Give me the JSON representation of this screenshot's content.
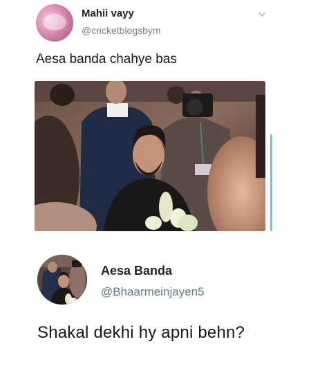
{
  "tweet": {
    "author_name": "Mahii vayy",
    "author_handle": "@cricketblogsbym",
    "text": "Aesa banda chahye bas",
    "menu_icon": "chevron-down-icon",
    "media_description_icon": "photo"
  },
  "reply": {
    "author_name": "Aesa Banda",
    "author_handle": "@Bhaarmeinjayen5",
    "text": "Shakal dekhi hy apni behn?"
  },
  "colors": {
    "handle": "#657786",
    "text": "#14171a",
    "scrollbar": "#6fc3ee"
  }
}
